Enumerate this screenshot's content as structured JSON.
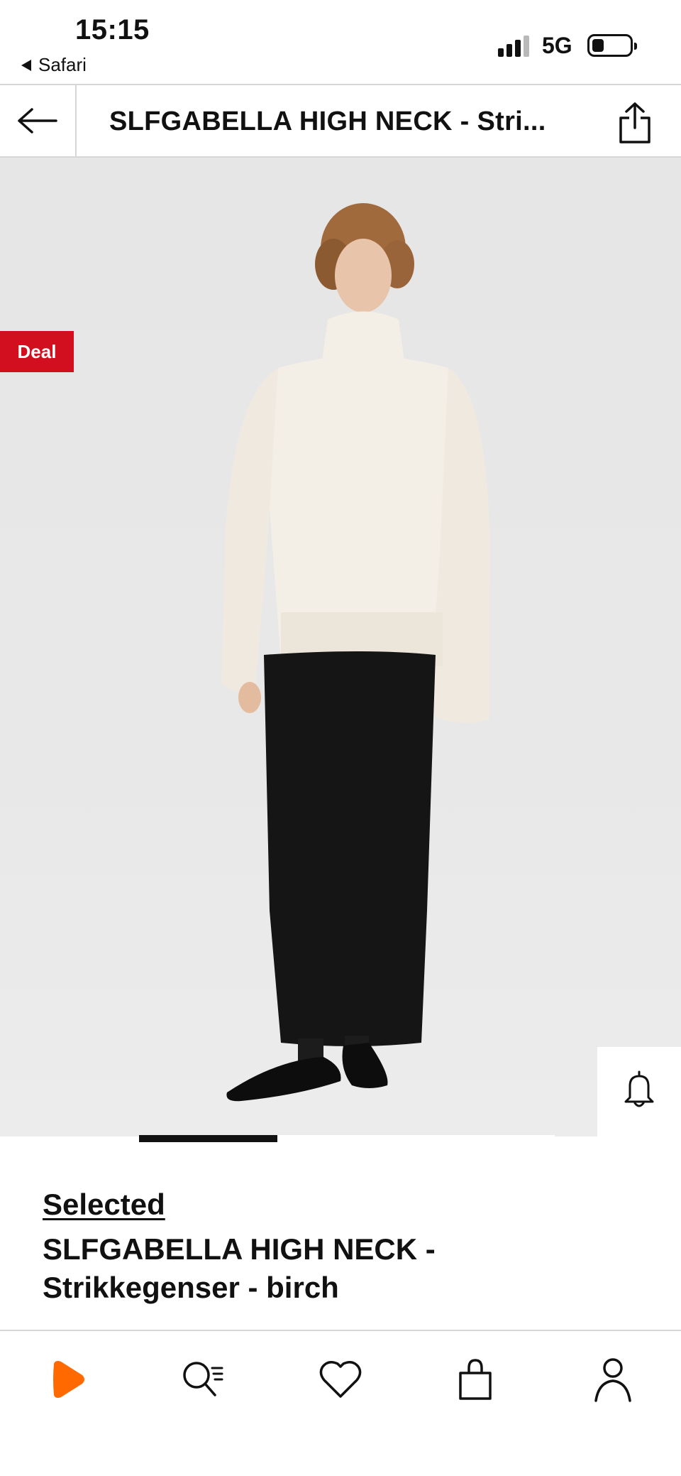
{
  "status_bar": {
    "time": "15:15",
    "back_app": "Safari",
    "network": "5G",
    "signal_bars_active": 3,
    "signal_bars_total": 4,
    "battery_level": 0.3
  },
  "header": {
    "title": "SLFGABELLA HIGH NECK - Stri..."
  },
  "product": {
    "badge": "Deal",
    "badge_color": "#d10f1e",
    "brand": "Selected",
    "name": "SLFGABELLA HIGH NECK - Strikkegenser - birch",
    "gallery_position": 1,
    "gallery_count": 3
  },
  "icons": {
    "back": "arrow-left-icon",
    "share": "share-icon",
    "notify": "bell-icon",
    "wishlist": "heart-icon",
    "add_to_bag": "shopping-bag-icon",
    "similar": "similar-items-icon"
  },
  "bottom_nav": {
    "items": [
      {
        "name": "home",
        "icon": "zalando-logo-icon",
        "accent": "#ff6900"
      },
      {
        "name": "search",
        "icon": "search-icon"
      },
      {
        "name": "wishlist",
        "icon": "heart-icon"
      },
      {
        "name": "bag",
        "icon": "shopping-bag-icon"
      },
      {
        "name": "account",
        "icon": "user-icon"
      }
    ]
  }
}
